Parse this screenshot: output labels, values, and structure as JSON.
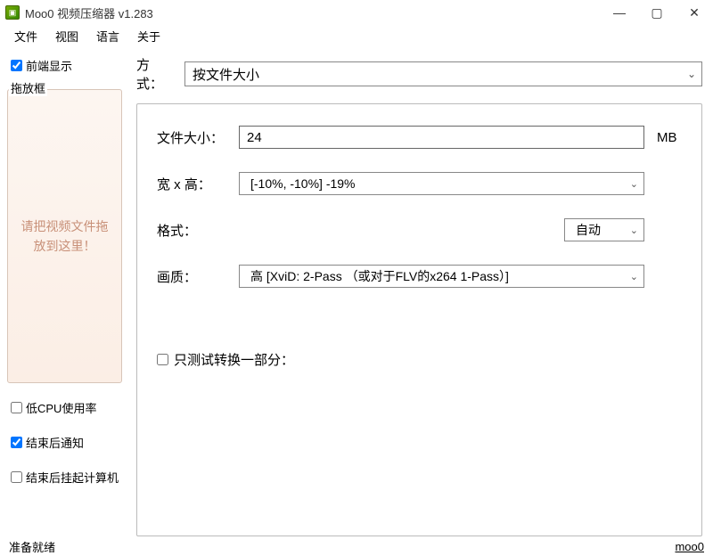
{
  "window": {
    "title": "Moo0 视频压缩器 v1.283"
  },
  "menu": {
    "file": "文件",
    "view": "视图",
    "language": "语言",
    "about": "关于"
  },
  "sidebar": {
    "always_on_top": "前端显示",
    "drop_frame_label": "拖放框",
    "drop_hint": "请把视频文件拖放到这里！",
    "low_cpu": "低CPU使用率",
    "notify_done": "结束后通知",
    "suspend_after": "结束后挂起计算机"
  },
  "checks": {
    "always_on_top": true,
    "low_cpu": false,
    "notify_done": true,
    "suspend_after": false,
    "test_portion": false
  },
  "main": {
    "mode_label": "方式：",
    "mode_value": "按文件大小",
    "filesize_label": "文件大小：",
    "filesize_value": "24",
    "filesize_unit": "MB",
    "wh_label": "宽 x 高：",
    "wh_value": "[-10%, -10%]    -19%",
    "format_label": "格式：",
    "format_value": "自动",
    "quality_label": "画质：",
    "quality_value": "高       [XviD: 2-Pass  （或对于FLV的x264 1-Pass）]",
    "test_portion_label": "只测试转换一部分："
  },
  "status": {
    "ready": "准备就绪",
    "link": "moo0"
  }
}
